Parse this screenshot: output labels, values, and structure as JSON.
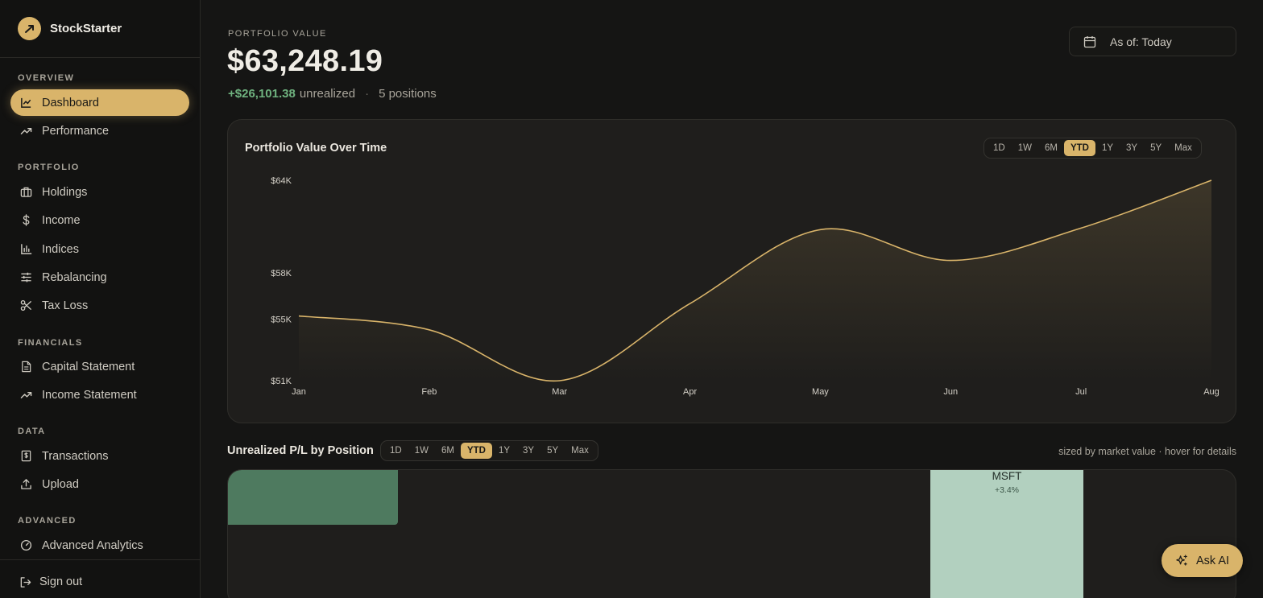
{
  "brand": {
    "name": "StockStarter"
  },
  "sidebar": {
    "sections": [
      {
        "label": "OVERVIEW"
      },
      {
        "label": "PORTFOLIO"
      },
      {
        "label": "FINANCIALS"
      },
      {
        "label": "DATA"
      },
      {
        "label": "ADVANCED"
      }
    ],
    "items": [
      {
        "label": "Dashboard",
        "icon": "line-chart-icon",
        "active": true
      },
      {
        "label": "Performance",
        "icon": "trending-up-icon"
      },
      {
        "label": "Holdings",
        "icon": "briefcase-icon"
      },
      {
        "label": "Income",
        "icon": "dollar-icon"
      },
      {
        "label": "Indices",
        "icon": "bar-chart-icon"
      },
      {
        "label": "Rebalancing",
        "icon": "sliders-icon"
      },
      {
        "label": "Tax Loss",
        "icon": "scissors-icon"
      },
      {
        "label": "Capital Statement",
        "icon": "document-icon"
      },
      {
        "label": "Income Statement",
        "icon": "trending-up-icon"
      },
      {
        "label": "Transactions",
        "icon": "receipt-icon"
      },
      {
        "label": "Upload",
        "icon": "upload-icon"
      },
      {
        "label": "Advanced Analytics",
        "icon": "gauge-icon"
      }
    ],
    "sign_out": "Sign out"
  },
  "header": {
    "label": "PORTFOLIO VALUE",
    "value": "$63,248.19",
    "gain": "+$26,101.38",
    "gain_suffix": "unrealized",
    "positions": "5 positions",
    "as_of": "As of: Today"
  },
  "value_chart": {
    "title": "Portfolio Value Over Time",
    "ranges": [
      "1D",
      "1W",
      "6M",
      "YTD",
      "1Y",
      "3Y",
      "5Y",
      "Max"
    ],
    "selected_range": "YTD"
  },
  "chart_data": {
    "type": "area",
    "title": "Portfolio Value Over Time",
    "x": [
      "Jan",
      "Feb",
      "Mar",
      "Apr",
      "May",
      "Jun",
      "Jul",
      "Aug"
    ],
    "series": [
      {
        "values": [
          55200,
          54300,
          51000,
          56000,
          60800,
          58800,
          60900,
          64000
        ]
      }
    ],
    "y_ticks": [
      51000,
      55000,
      58000,
      64000
    ],
    "y_tick_labels": [
      "$51K",
      "$55K",
      "$58K",
      "$64K"
    ],
    "ylim": [
      51000,
      64000
    ],
    "grid": false,
    "color": "#d9b46a"
  },
  "pl_section": {
    "title": "Unrealized P/L by Position",
    "ranges": [
      "1D",
      "1W",
      "6M",
      "YTD",
      "1Y",
      "3Y",
      "5Y",
      "Max"
    ],
    "selected_range": "YTD",
    "note": "sized by market value · hover for details",
    "tiles": [
      {
        "ticker": "MSFT",
        "change": "+3.4%"
      }
    ]
  },
  "ask_ai": {
    "label": "Ask AI"
  },
  "colors": {
    "accent": "#d9b46a",
    "gain": "#6fb27f",
    "background": "#151514"
  }
}
